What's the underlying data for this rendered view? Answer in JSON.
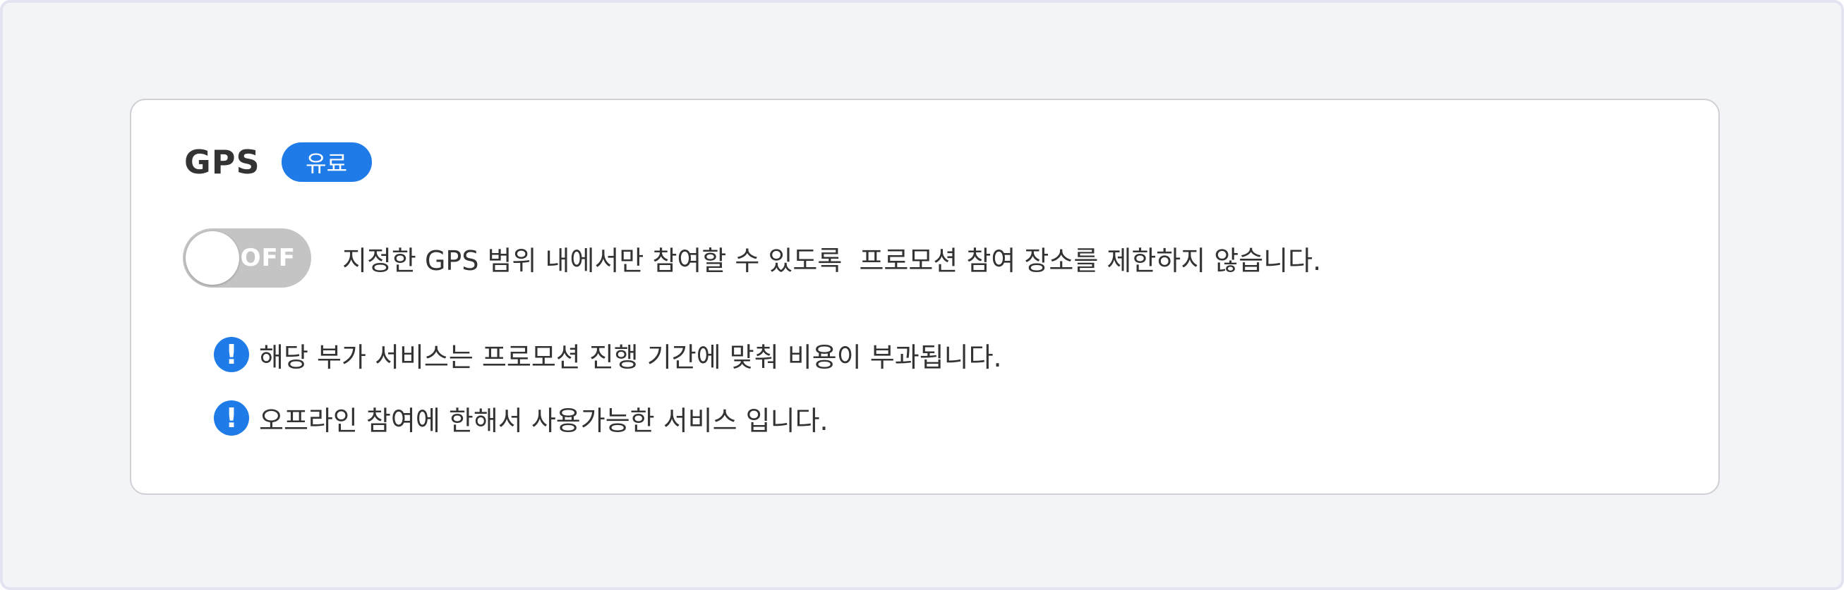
{
  "gps_setting": {
    "title": "GPS",
    "badge": "유료",
    "toggle": {
      "state_label": "OFF",
      "is_on": false
    },
    "description": "지정한 GPS 범위 내에서만 참여할 수 있도록  프로모션 참여 장소를 제한하지 않습니다.",
    "notices": [
      {
        "icon": "exclamation-icon",
        "text": "해당 부가 서비스는 프로모션 진행 기간에 맞춰 비용이 부과됩니다."
      },
      {
        "icon": "exclamation-icon",
        "text": "오프라인 참여에 한해서 사용가능한 서비스 입니다."
      }
    ],
    "colors": {
      "accent": "#1e7be8",
      "toggle_off": "#c4c4c4",
      "page_bg": "#f3f4f8",
      "card_border": "#cfcfd4"
    }
  }
}
